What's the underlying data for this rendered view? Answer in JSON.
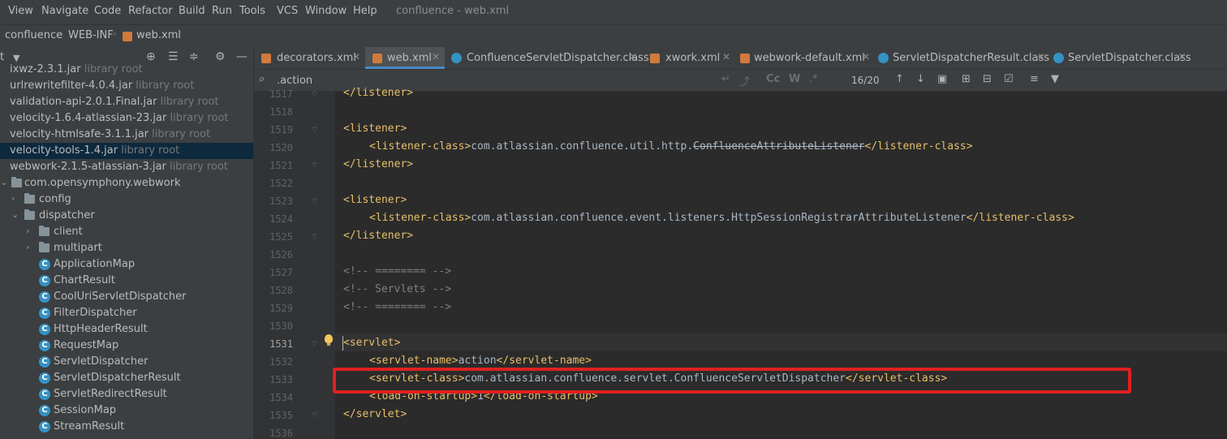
{
  "menu": [
    "View",
    "Navigate",
    "Code",
    "Refactor",
    "Build",
    "Run",
    "Tools",
    "VCS",
    "Window",
    "Help"
  ],
  "window_title": "confluence - web.xml",
  "breadcrumb": [
    "confluence",
    "WEB-INF",
    "web.xml"
  ],
  "project_panel": {
    "title": "t",
    "tree": [
      {
        "label": "ixwz-2.3.1.jar",
        "sub": "library root",
        "depth": 0,
        "kind": "jar"
      },
      {
        "label": "urlrewritefilter-4.0.4.jar",
        "sub": "library root",
        "depth": 0,
        "kind": "jar"
      },
      {
        "label": "validation-api-2.0.1.Final.jar",
        "sub": "library root",
        "depth": 0,
        "kind": "jar"
      },
      {
        "label": "velocity-1.6.4-atlassian-23.jar",
        "sub": "library root",
        "depth": 0,
        "kind": "jar"
      },
      {
        "label": "velocity-htmlsafe-3.1.1.jar",
        "sub": "library root",
        "depth": 0,
        "kind": "jar"
      },
      {
        "label": "velocity-tools-1.4.jar",
        "sub": "library root",
        "depth": 0,
        "kind": "jar",
        "selected": true
      },
      {
        "label": "webwork-2.1.5-atlassian-3.jar",
        "sub": "library root",
        "depth": 0,
        "kind": "jar"
      },
      {
        "label": "com.opensymphony.webwork",
        "sub": "",
        "depth": 1,
        "kind": "package",
        "arrow": "v"
      },
      {
        "label": "config",
        "sub": "",
        "depth": 2,
        "kind": "folder",
        "arrow": ">"
      },
      {
        "label": "dispatcher",
        "sub": "",
        "depth": 2,
        "kind": "folder",
        "arrow": "v"
      },
      {
        "label": "client",
        "sub": "",
        "depth": 3,
        "kind": "folder",
        "arrow": ">"
      },
      {
        "label": "multipart",
        "sub": "",
        "depth": 3,
        "kind": "folder",
        "arrow": ">"
      },
      {
        "label": "ApplicationMap",
        "sub": "",
        "depth": 3,
        "kind": "class"
      },
      {
        "label": "ChartResult",
        "sub": "",
        "depth": 3,
        "kind": "class"
      },
      {
        "label": "CoolUriServletDispatcher",
        "sub": "",
        "depth": 3,
        "kind": "class"
      },
      {
        "label": "FilterDispatcher",
        "sub": "",
        "depth": 3,
        "kind": "class"
      },
      {
        "label": "HttpHeaderResult",
        "sub": "",
        "depth": 3,
        "kind": "class"
      },
      {
        "label": "RequestMap",
        "sub": "",
        "depth": 3,
        "kind": "class"
      },
      {
        "label": "ServletDispatcher",
        "sub": "",
        "depth": 3,
        "kind": "class"
      },
      {
        "label": "ServletDispatcherResult",
        "sub": "",
        "depth": 3,
        "kind": "class"
      },
      {
        "label": "ServletRedirectResult",
        "sub": "",
        "depth": 3,
        "kind": "class"
      },
      {
        "label": "SessionMap",
        "sub": "",
        "depth": 3,
        "kind": "class"
      },
      {
        "label": "StreamResult",
        "sub": "",
        "depth": 3,
        "kind": "class"
      }
    ]
  },
  "tabs": [
    {
      "label": "decorators.xml",
      "icon": "xml-file-icon"
    },
    {
      "label": "web.xml",
      "icon": "xml-file-icon",
      "active": true
    },
    {
      "label": "ConfluenceServletDispatcher.class",
      "icon": "class-file-icon"
    },
    {
      "label": "xwork.xml",
      "icon": "xml-file-icon"
    },
    {
      "label": "webwork-default.xml",
      "icon": "xml-file-icon"
    },
    {
      "label": "ServletDispatcherResult.class",
      "icon": "class-file-icon"
    },
    {
      "label": "ServletDispatcher.class",
      "icon": "class-file-icon"
    }
  ],
  "search": {
    "value": ".action",
    "match_case": "Cc",
    "words": "W",
    "regex": ".*",
    "match_count": "16/20"
  },
  "editor": {
    "lines": [
      {
        "num": "1517",
        "parts": [
          [
            "tag",
            "</listener>"
          ]
        ],
        "indent": 1
      },
      {
        "num": "1518",
        "parts": [],
        "indent": 0
      },
      {
        "num": "1519",
        "parts": [
          [
            "tag",
            "<listener>"
          ]
        ],
        "indent": 1
      },
      {
        "num": "1520",
        "parts": [
          [
            "tag",
            "<listener-class>"
          ],
          [
            "txt",
            "com.atlassian.confluence.util.http."
          ],
          [
            "strike",
            "ConfluenceAttributeListener"
          ],
          [
            "tag",
            "</listener-class>"
          ]
        ],
        "indent": 2
      },
      {
        "num": "1521",
        "parts": [
          [
            "tag",
            "</listener>"
          ]
        ],
        "indent": 1
      },
      {
        "num": "1522",
        "parts": [],
        "indent": 0
      },
      {
        "num": "1523",
        "parts": [
          [
            "tag",
            "<listener>"
          ]
        ],
        "indent": 1
      },
      {
        "num": "1524",
        "parts": [
          [
            "tag",
            "<listener-class>"
          ],
          [
            "txt",
            "com.atlassian.confluence.event.listeners.HttpSessionRegistrarAttributeListener"
          ],
          [
            "tag",
            "</listener-class>"
          ]
        ],
        "indent": 2
      },
      {
        "num": "1525",
        "parts": [
          [
            "tag",
            "</listener>"
          ]
        ],
        "indent": 1
      },
      {
        "num": "1526",
        "parts": [],
        "indent": 0
      },
      {
        "num": "1527",
        "parts": [
          [
            "cmt",
            "<!-- ======== -->"
          ]
        ],
        "indent": 1
      },
      {
        "num": "1528",
        "parts": [
          [
            "cmt",
            "<!-- Servlets -->"
          ]
        ],
        "indent": 1
      },
      {
        "num": "1529",
        "parts": [
          [
            "cmt",
            "<!-- ======== -->"
          ]
        ],
        "indent": 1
      },
      {
        "num": "1530",
        "parts": [],
        "indent": 0
      },
      {
        "num": "1531",
        "parts": [
          [
            "tag",
            "<servlet>"
          ]
        ],
        "indent": 1,
        "current": true
      },
      {
        "num": "1532",
        "parts": [
          [
            "tag",
            "<servlet-name>"
          ],
          [
            "txt",
            "action"
          ],
          [
            "tag",
            "</servlet-name>"
          ]
        ],
        "indent": 2
      },
      {
        "num": "1533",
        "parts": [
          [
            "tag",
            "<servlet-class>"
          ],
          [
            "txt",
            "com.atlassian.confluence.servlet.ConfluenceServletDispatcher"
          ],
          [
            "tag",
            "</servlet-class>"
          ]
        ],
        "indent": 2
      },
      {
        "num": "1534",
        "parts": [
          [
            "tag",
            "<load-on-startup>"
          ],
          [
            "txt",
            "1"
          ],
          [
            "tag",
            "</load-on-startup>"
          ]
        ],
        "indent": 2
      },
      {
        "num": "1535",
        "parts": [
          [
            "tag",
            "</servlet>"
          ]
        ],
        "indent": 1
      },
      {
        "num": "1536",
        "parts": [],
        "indent": 0
      }
    ]
  },
  "colors": {
    "highlight": "#e02020",
    "tag": "#e8bf6a",
    "text": "#a9b7c6",
    "comment": "#808080",
    "selection": "#0d293e"
  }
}
